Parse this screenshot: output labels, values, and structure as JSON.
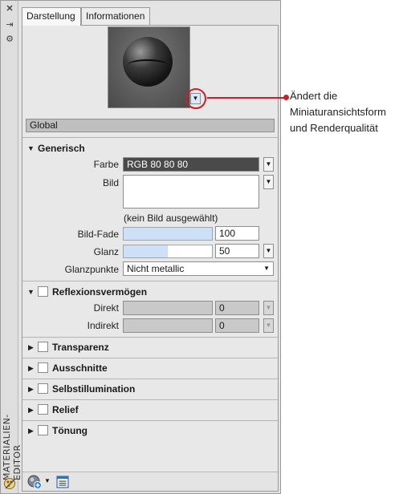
{
  "palette": {
    "vertical_title": "MATERIALIEN-EDITOR"
  },
  "tabs": [
    {
      "label": "Darstellung"
    },
    {
      "label": "Informationen"
    }
  ],
  "callout": {
    "line1": "Ändert die",
    "line2": "Miniaturansichtsform",
    "line3": "und Renderqualität"
  },
  "global": {
    "label": "Global"
  },
  "generisch": {
    "title": "Generisch",
    "farbe_label": "Farbe",
    "farbe_value": "RGB 80 80 80",
    "bild_label": "Bild",
    "bild_note": "(kein Bild ausgewählt)",
    "bildfade_label": "Bild-Fade",
    "bildfade_value": "100",
    "bildfade_fraction": 1.0,
    "glanz_label": "Glanz",
    "glanz_value": "50",
    "glanz_fraction": 0.5,
    "glanzpunkte_label": "Glanzpunkte",
    "glanzpunkte_value": "Nicht metallic"
  },
  "reflexion": {
    "title": "Reflexionsvermögen",
    "direkt_label": "Direkt",
    "direkt_value": "0",
    "indirekt_label": "Indirekt",
    "indirekt_value": "0"
  },
  "sections": [
    {
      "title": "Transparenz"
    },
    {
      "title": "Ausschnitte"
    },
    {
      "title": "Selbstillumination"
    },
    {
      "title": "Relief"
    },
    {
      "title": "Tönung"
    }
  ],
  "colors": {
    "accent_red": "#c8202a",
    "farbe_swatch": "#4a4a4a",
    "slider_fill": "#cde0f5"
  }
}
